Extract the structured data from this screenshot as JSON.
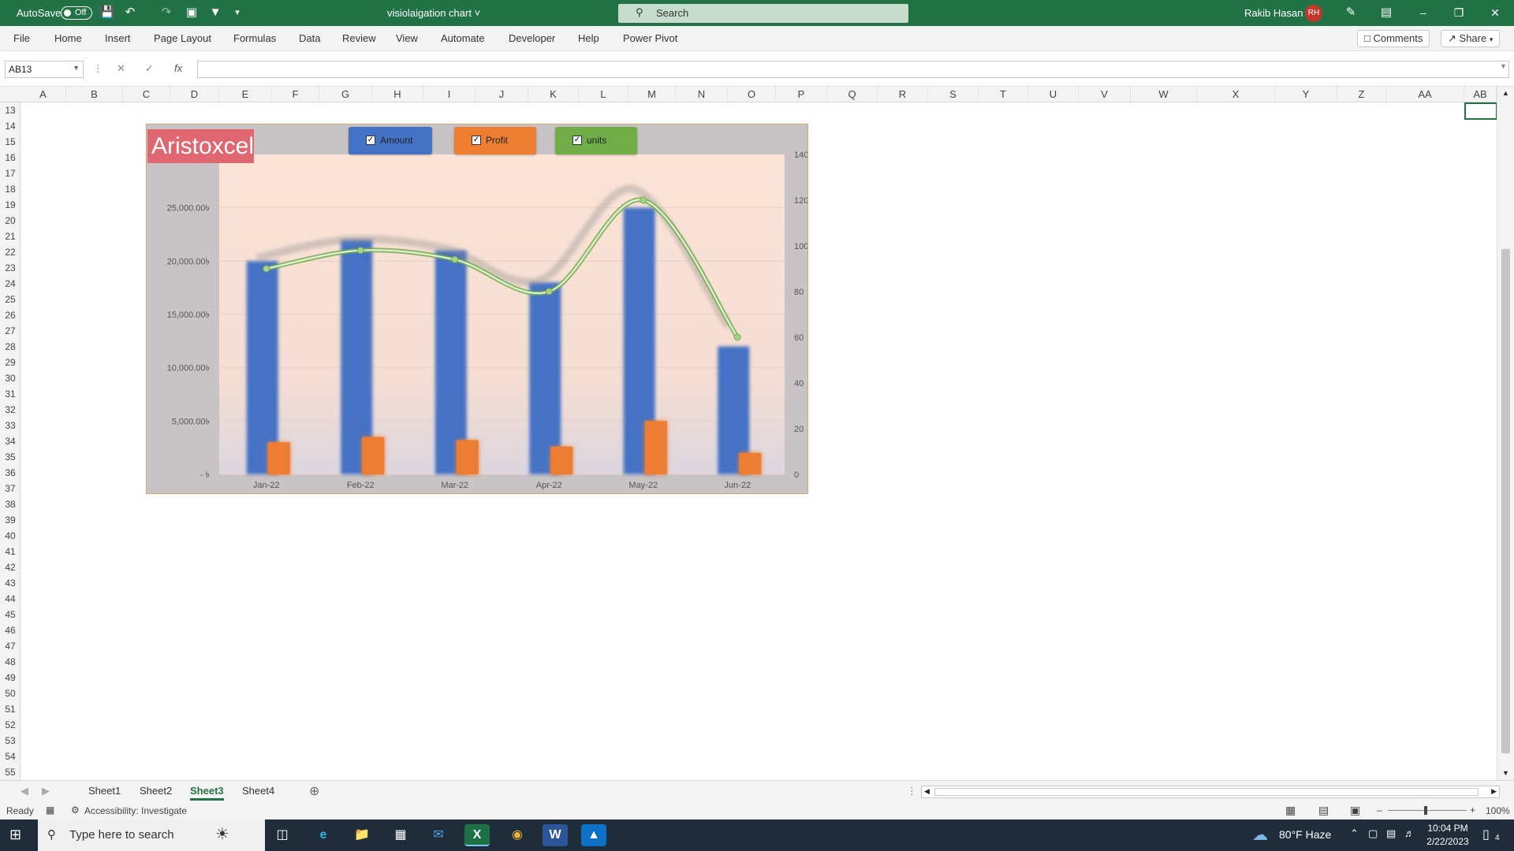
{
  "titlebar": {
    "autosave_label": "AutoSave",
    "autosave_state": "Off",
    "filename": "visiolaigation chart",
    "search_placeholder": "Search",
    "user_name": "Rakib Hasan",
    "user_initials": "RH"
  },
  "ribbon": {
    "tabs": [
      "File",
      "Home",
      "Insert",
      "Page Layout",
      "Formulas",
      "Data",
      "Review",
      "View",
      "Automate",
      "Developer",
      "Help",
      "Power Pivot"
    ],
    "comments_label": "Comments",
    "share_label": "Share"
  },
  "formula_bar": {
    "name_box": "AB13",
    "formula": ""
  },
  "grid": {
    "columns": [
      "A",
      "B",
      "C",
      "D",
      "E",
      "F",
      "G",
      "H",
      "I",
      "J",
      "K",
      "L",
      "M",
      "N",
      "O",
      "P",
      "Q",
      "R",
      "S",
      "T",
      "U",
      "V",
      "W",
      "X",
      "Y",
      "Z",
      "AA",
      "AB"
    ],
    "rows": [
      "13",
      "14",
      "15",
      "16",
      "17",
      "18",
      "19",
      "20",
      "21",
      "22",
      "23",
      "24",
      "25",
      "26",
      "27",
      "28",
      "29",
      "30",
      "31",
      "32",
      "33",
      "34",
      "35",
      "36",
      "37",
      "38",
      "39",
      "40",
      "41",
      "42",
      "43",
      "44",
      "45",
      "46",
      "47",
      "48",
      "49",
      "50",
      "51",
      "52",
      "53",
      "54",
      "55"
    ]
  },
  "chart": {
    "brand": "Aristoxcel",
    "legend": [
      {
        "label": "Amount",
        "color": "#4472c4"
      },
      {
        "label": "Profit",
        "color": "#ed7d31"
      },
      {
        "label": "units",
        "color": "#70ad47"
      }
    ]
  },
  "chart_data": {
    "type": "bar",
    "categories": [
      "Jan-22",
      "Feb-22",
      "Mar-22",
      "Apr-22",
      "May-22",
      "Jun-22"
    ],
    "series": [
      {
        "name": "Amount",
        "type": "bar",
        "axis": "left",
        "values": [
          20000,
          22000,
          21000,
          18000,
          25000,
          12000
        ],
        "color": "#4472c4"
      },
      {
        "name": "Profit",
        "type": "bar",
        "axis": "left",
        "values": [
          3000,
          3500,
          3200,
          2600,
          5000,
          2000
        ],
        "color": "#ed7d31"
      },
      {
        "name": "units",
        "type": "line",
        "axis": "right",
        "values": [
          90,
          98,
          94,
          80,
          120,
          60
        ],
        "color": "#70ad47"
      }
    ],
    "y_left_ticks": [
      "25,000.00৳",
      "20,000.00৳",
      "15,000.00৳",
      "10,000.00৳",
      "5,000.00৳",
      "-  ৳"
    ],
    "ylim_left": [
      0,
      30000
    ],
    "y_right_ticks": [
      "140",
      "120",
      "100",
      "80",
      "60",
      "40",
      "20",
      "0"
    ],
    "ylim_right": [
      0,
      140
    ],
    "grid": true
  },
  "sheets": {
    "tabs": [
      "Sheet1",
      "Sheet2",
      "Sheet3",
      "Sheet4"
    ],
    "active": "Sheet3"
  },
  "status": {
    "ready": "Ready",
    "accessibility": "Accessibility: Investigate",
    "zoom": "100%"
  },
  "taskbar": {
    "search_placeholder": "Type here to search",
    "weather": "80°F  Haze",
    "time": "10:04 PM",
    "date": "2/22/2023",
    "notifications": "4"
  }
}
